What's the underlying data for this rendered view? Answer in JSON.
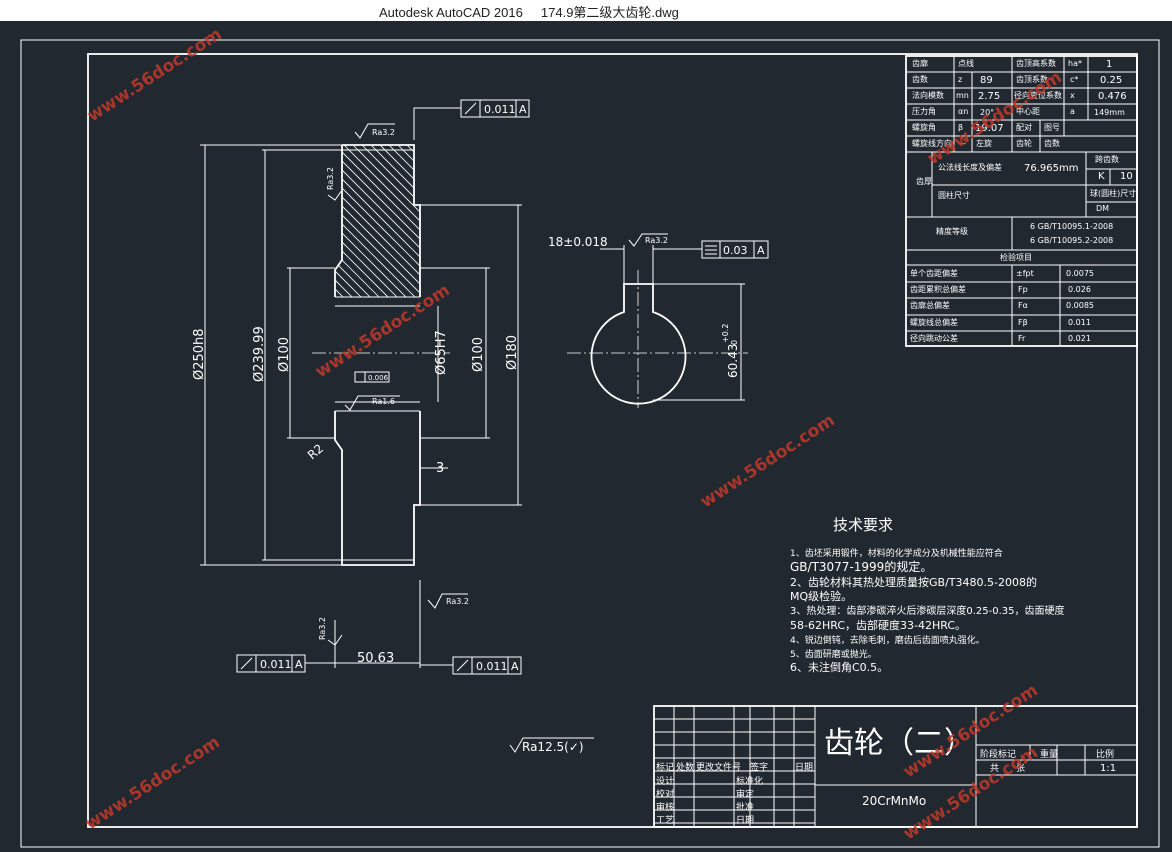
{
  "window": {
    "app_title": "Autodesk AutoCAD 2016",
    "file_name": "174.9第二级大齿轮.dwg"
  },
  "watermark": {
    "text": "www.56doc.com",
    "color": "#c0392b"
  },
  "drawing": {
    "dimensions": {
      "od": "Ø250h8",
      "d239": "Ø239.99",
      "d100_left": "Ø100",
      "bore": "Ø65H7",
      "d100_right": "Ø100",
      "d180": "Ø180",
      "width": "50.63",
      "step": "3",
      "fillet": "R2",
      "keyway_width": "18±0.018",
      "keyway_depth": "60.43",
      "keyway_tol": "+0.2",
      "keyway_tol_low": "0"
    },
    "roughness": {
      "top": "Ra3.2",
      "left_face": "Ra3.2",
      "bore_face": "Ra1.6",
      "right_face": "Ra3.2",
      "bottom_left": "Ra3.2",
      "keyway": "Ra3.2",
      "general": "Ra12.5(✓)"
    },
    "tolerances": {
      "top": {
        "value": "0.011",
        "datum": "A"
      },
      "bottom_left": {
        "value": "0.011",
        "datum": "A"
      },
      "bottom_right": {
        "value": "0.011",
        "datum": "A"
      },
      "keyway": {
        "value": "0.03",
        "datum": "A"
      },
      "bore_run": "0.006"
    }
  },
  "param_table": {
    "rows": [
      [
        "齿廓",
        "点线",
        "齿顶高系数",
        "ha*",
        "1"
      ],
      [
        "齿数",
        "z",
        "89",
        "齿顶系数",
        "c*",
        "0.25"
      ],
      [
        "法向模数",
        "mn",
        "2.75",
        "径向变位系数",
        "x",
        "0.476"
      ],
      [
        "压力角",
        "αn",
        "20°",
        "中心距",
        "a",
        "149mm"
      ],
      [
        "螺旋角",
        "β",
        "19.07",
        "配对",
        "图号",
        ""
      ],
      [
        "螺旋线方向",
        "—",
        "左旋",
        "齿轮",
        "齿数",
        ""
      ]
    ],
    "tooth_thickness": {
      "group": "齿厚",
      "common_normal": "公法线长度及偏差",
      "common_normal_value": "76.965mm",
      "span_label": "跨齿数",
      "span_k": "K",
      "span_value": "10",
      "ball_label": "圆柱尺寸",
      "ball_dim": "球(圆柱)尺寸",
      "ball_dh": "DM"
    },
    "accuracy": {
      "label": "精度等级",
      "line1": "6 GB/T10095.1-2008",
      "line2": "6 GB/T10095.2-2008"
    },
    "inspection_title": "检验项目",
    "inspection": [
      [
        "单个齿距偏差",
        "±fpt",
        "0.0075"
      ],
      [
        "齿距累积总偏差",
        "Fp",
        "0.026"
      ],
      [
        "齿廓总偏差",
        "Fα",
        "0.0085"
      ],
      [
        "螺旋线总偏差",
        "Fβ",
        "0.011"
      ],
      [
        "径向跳动公差",
        "Fr",
        "0.021"
      ]
    ]
  },
  "tech_requirements": {
    "title": "技术要求",
    "lines": [
      "1、齿坯采用锻件，材料的化学成分及机械性能应符合",
      "GB/T3077-1999的规定。",
      "2、齿轮材料其热处理质量按GB/T3480.5-2008的",
      "MQ级检验。",
      "3、热处理：齿部渗碳淬火后渗碳层深度0.25-0.35，齿面硬度",
      "58-62HRC，齿部硬度33-42HRC。",
      "4、锐边倒钝，去除毛刺，磨齿后齿面喷丸强化。",
      "5、齿面研磨或抛光。",
      "6、未注倒角C0.5。"
    ]
  },
  "title_block": {
    "name": "齿轮（二）",
    "material": "20CrMnMo",
    "stage_label": "阶段标记",
    "weight_label": "重量",
    "scale_label": "比例",
    "scale": "1:1",
    "sheet_label": "共",
    "sheet_of": "张",
    "rev_labels": [
      "标记",
      "处数",
      "更改文件号",
      "签字",
      "日期"
    ],
    "rows_left": [
      "设计",
      "校对",
      "审核",
      "工艺"
    ],
    "rows_mid": [
      "标准化",
      "审定",
      "批准",
      "日期"
    ]
  }
}
